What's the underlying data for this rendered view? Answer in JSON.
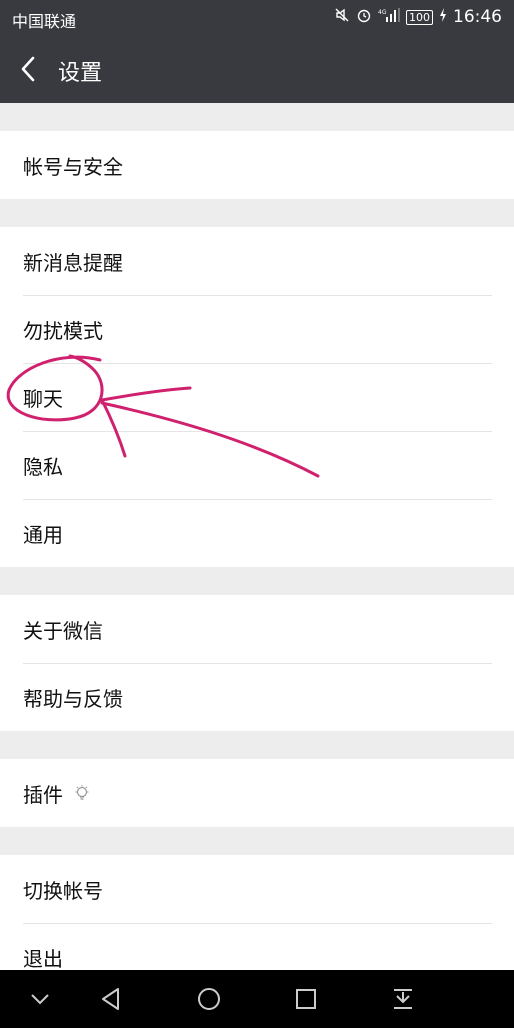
{
  "status_bar": {
    "carrier": "中国联通",
    "battery": "100",
    "time": "16:46"
  },
  "header": {
    "title": "设置"
  },
  "groups": [
    [
      "帐号与安全"
    ],
    [
      "新消息提醒",
      "勿扰模式",
      "聊天",
      "隐私",
      "通用"
    ],
    [
      "关于微信",
      "帮助与反馈"
    ],
    [
      "插件"
    ],
    [
      "切换帐号",
      "退出"
    ]
  ],
  "icons": {
    "back": "chevron-left-icon",
    "plugin_badge": "lightbulb-icon",
    "nav": [
      "chevron-down-icon",
      "back-triangle-icon",
      "home-circle-icon",
      "recents-square-icon",
      "notification-pull-icon"
    ]
  },
  "colors": {
    "header_bg": "#393a3f",
    "page_bg": "#ededed",
    "annotation": "#d0216e"
  }
}
